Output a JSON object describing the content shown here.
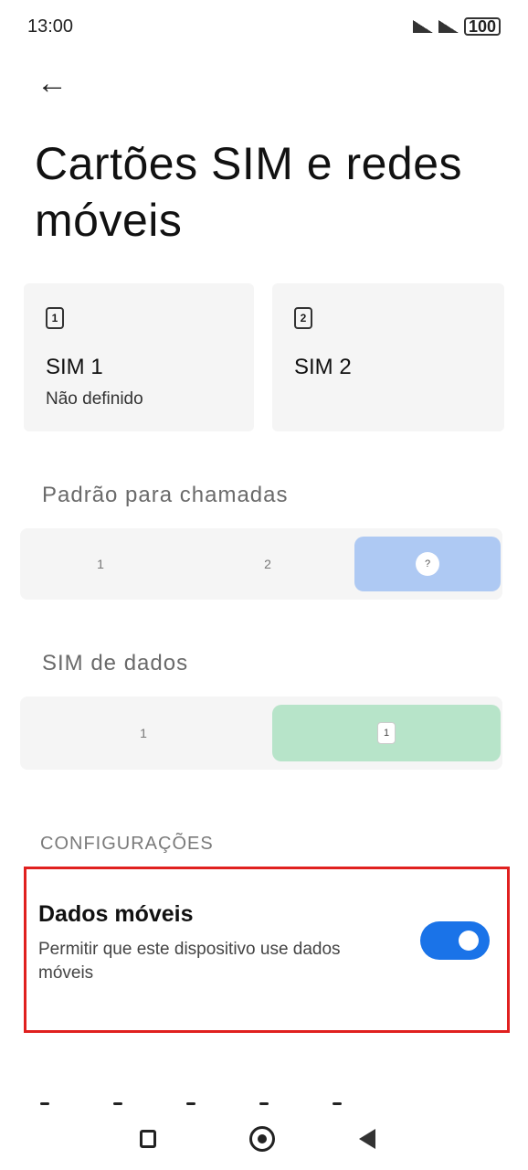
{
  "status_bar": {
    "time": "13:00",
    "battery": "100"
  },
  "header": {
    "back_icon": "←",
    "title": "Cartões SIM e redes móveis"
  },
  "sim_cards": [
    {
      "icon": "1",
      "name": "SIM 1",
      "status": "Não definido"
    },
    {
      "icon": "2",
      "name": "SIM 2",
      "status": ""
    }
  ],
  "default_calls": {
    "label": "Padrão para chamadas",
    "options": [
      {
        "label": "1"
      },
      {
        "label": "2"
      },
      {
        "label": "?"
      }
    ],
    "selected_index": 2,
    "selected_color": "#aec9f3"
  },
  "data_sim": {
    "label": "SIM de dados",
    "options": [
      {
        "label": "1"
      },
      {
        "label": "1"
      }
    ],
    "selected_index": 1,
    "selected_color": "#b7e4c9"
  },
  "config": {
    "label": "CONFIGURAÇÕES"
  },
  "mobile_data": {
    "title": "Dados móveis",
    "description": "Permitir que este dispositivo use dados móveis",
    "enabled": true,
    "toggle_color": "#1a73e8"
  },
  "highlight_color": "#e0201f"
}
